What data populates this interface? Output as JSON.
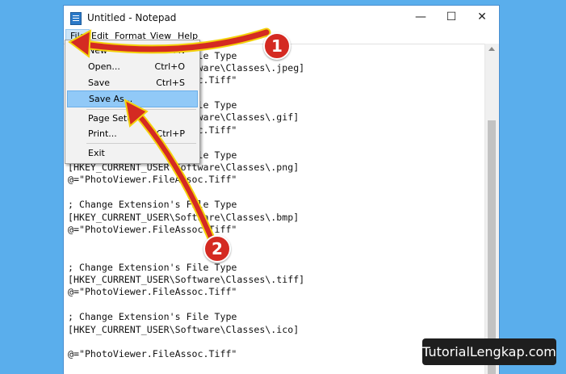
{
  "window": {
    "title": "Untitled - Notepad",
    "controls": {
      "minimize": "—",
      "maximize": "☐",
      "close": "✕"
    }
  },
  "menubar": {
    "items": [
      "File",
      "Edit",
      "Format",
      "View",
      "Help"
    ]
  },
  "file_menu": {
    "items": [
      {
        "label": "New",
        "shortcut": "Ctrl+N"
      },
      {
        "label": "Open...",
        "shortcut": "Ctrl+O"
      },
      {
        "label": "Save",
        "shortcut": "Ctrl+S"
      },
      {
        "label": "Save As...",
        "shortcut": ""
      },
      {
        "label": "Page Setup...",
        "shortcut": ""
      },
      {
        "label": "Print...",
        "shortcut": "Ctrl+P"
      },
      {
        "label": "Exit",
        "shortcut": ""
      }
    ]
  },
  "editor": {
    "lines": [
      "; Change Extension's File Type",
      "[HKEY_CURRENT_USER\\Software\\Classes\\.jpeg]",
      "@=\"PhotoViewer.FileAssoc.Tiff\"",
      "",
      "; Change Extension's File Type",
      "[HKEY_CURRENT_USER\\Software\\Classes\\.gif]",
      "@=\"PhotoViewer.FileAssoc.Tiff\"",
      "",
      "; Change Extension's File Type",
      "[HKEY_CURRENT_USER\\Software\\Classes\\.png]",
      "@=\"PhotoViewer.FileAssoc.Tiff\"",
      "",
      "; Change Extension's File Type",
      "[HKEY_CURRENT_USER\\Software\\Classes\\.bmp]",
      "@=\"PhotoViewer.FileAssoc.Tiff\"",
      "",
      "",
      "; Change Extension's File Type",
      "[HKEY_CURRENT_USER\\Software\\Classes\\.tiff]",
      "@=\"PhotoViewer.FileAssoc.Tiff\"",
      "",
      "; Change Extension's File Type",
      "[HKEY_CURRENT_USER\\Software\\Classes\\.ico]",
      "",
      "@=\"PhotoViewer.FileAssoc.Tiff\""
    ]
  },
  "annotations": {
    "step1": "1",
    "step2": "2",
    "arrow_color": "#d42a22",
    "arrow_outline": "#f4d20c"
  },
  "watermark": "TutorialLengkap.com"
}
